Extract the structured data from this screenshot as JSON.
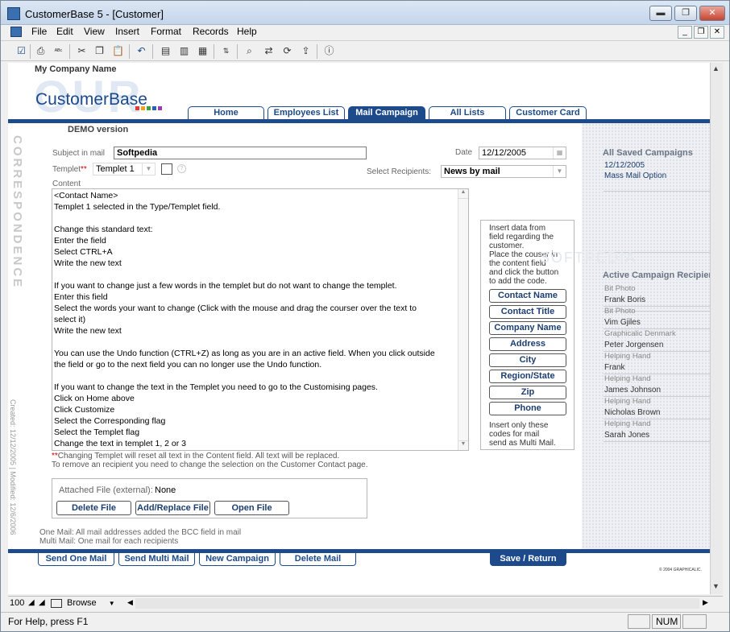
{
  "window": {
    "title": "CustomerBase 5 - [Customer]",
    "controls": {
      "minimize": "▬",
      "maximize": "❐",
      "close": "✕"
    }
  },
  "menu": {
    "items": [
      "File",
      "Edit",
      "View",
      "Insert",
      "Format",
      "Records",
      "Help"
    ],
    "mdi": {
      "minimize": "_",
      "restore": "❐",
      "close": "✕"
    }
  },
  "toolbar": {
    "icons": [
      "check-icon",
      "print-icon",
      "spellcheck-icon",
      "cut-icon",
      "copy-icon",
      "paste-icon",
      "undo-icon",
      "new-record-icon",
      "duplicate-icon",
      "delete-record-icon",
      "sort-icon",
      "find-icon",
      "connect-icon",
      "sync-icon",
      "export-icon",
      "info-icon"
    ]
  },
  "header": {
    "company_name": "My Company Name",
    "logo_our": "OUR",
    "logo_text": "CustomerBase",
    "logo_colors": [
      "#e23a3a",
      "#f0a020",
      "#3aa33a",
      "#2d5fb5",
      "#9b3ab5"
    ],
    "demo": "DEMO version"
  },
  "nav": {
    "tabs": [
      "Home",
      "Employees List",
      "Mail Campaign",
      "All Lists",
      "Customer Card"
    ],
    "active": "Mail Campaign"
  },
  "side": {
    "vertical_title": "CORRESPONDENCE",
    "created": "Created: 12/12/2005 | Modified: 12/6/2006"
  },
  "form": {
    "subject_label": "Subject in mail",
    "subject_value": "Softpedia",
    "date_label": "Date",
    "date_value": "12/12/2005",
    "templet_label": "Templet",
    "templet_required": "**",
    "templet_value": "Templet 1",
    "recipients_label": "Select Recipients:",
    "recipients_value": "News by mail",
    "content_label": "Content",
    "content_lines": [
      "<Contact Name>",
      "Templet 1 selected in the Type/Templet field.",
      "",
      "Change this standard text:",
      "Enter the field",
      "Select CTRL+A",
      "Write the new text",
      "",
      "If you want to change just a few words in the templet but do not want to change the templet.",
      "Enter this field",
      "Select the words your want to change (Click with the mouse and drag the courser over the text to",
      "select it)",
      "Write the new text",
      "",
      "You can use the Undo function (CTRL+Z) as long as you are in an active field. When you click outside",
      "the field or go to the next field you can no longer use the Undo function.",
      "",
      "If you want to change the text in the Templet you need to go to the Customising pages.",
      "Click on Home above",
      "Click Customize",
      "Select the Corresponding flag",
      "Select the Templet flag",
      "Change the text in templet 1, 2 or 3"
    ],
    "note_prefix": "**",
    "note1": "Changing Templet will reset all text in the Content field. All text will be replaced.",
    "note2": "To remove an recipient you need to change the selection on the Customer Contact page."
  },
  "insert_panel": {
    "intro": [
      "Insert data from",
      "field regarding the",
      "customer.",
      "Place the couser in",
      "the content field",
      "and click the button",
      "to add the code."
    ],
    "buttons": [
      "Contact Name",
      "Contact Title",
      "Company Name",
      "Address",
      "City",
      "Region/State",
      "Zip",
      "Phone"
    ],
    "footer": [
      "Insert only these",
      "codes for mail",
      "send as Multi Mail."
    ]
  },
  "attach": {
    "label": "Attached File (external):",
    "value": "None",
    "buttons": [
      "Delete File",
      "Add/Replace File",
      "Open File"
    ]
  },
  "mail_notes": [
    "One Mail: All mail addresses added the BCC field in mail",
    "Multi Mail: One mail for each recipients"
  ],
  "bottom_buttons": [
    "Send One Mail",
    "Send Multi Mail",
    "New Campaign",
    "Delete Mail"
  ],
  "save_return": "Save / Return",
  "copyright": "© 2004 GRAPHICALIC.",
  "right_panel": {
    "saved_title": "All Saved Campaigns",
    "saved_date": "12/12/2005",
    "saved_name": "Mass Mail Option",
    "watermark": "SOFTPEDIA",
    "active_title": "Active Campaign Recipients",
    "recipients": [
      {
        "company": "Bit Photo",
        "name": "Frank Boris"
      },
      {
        "company": "Bit Photo",
        "name": "Vim Gjiles"
      },
      {
        "company": "Graphicalic Denmark",
        "name": "Peter Jorgensen"
      },
      {
        "company": "Helping Hand",
        "name": "Frank"
      },
      {
        "company": "Helping Hand",
        "name": "James Johnson"
      },
      {
        "company": "Helping Hand",
        "name": "Nicholas Brown"
      },
      {
        "company": "Helping Hand",
        "name": "Sarah Jones"
      }
    ]
  },
  "hbar": {
    "zoom": "100",
    "mode": "Browse"
  },
  "status": {
    "help": "For Help, press F1",
    "num": "NUM"
  }
}
